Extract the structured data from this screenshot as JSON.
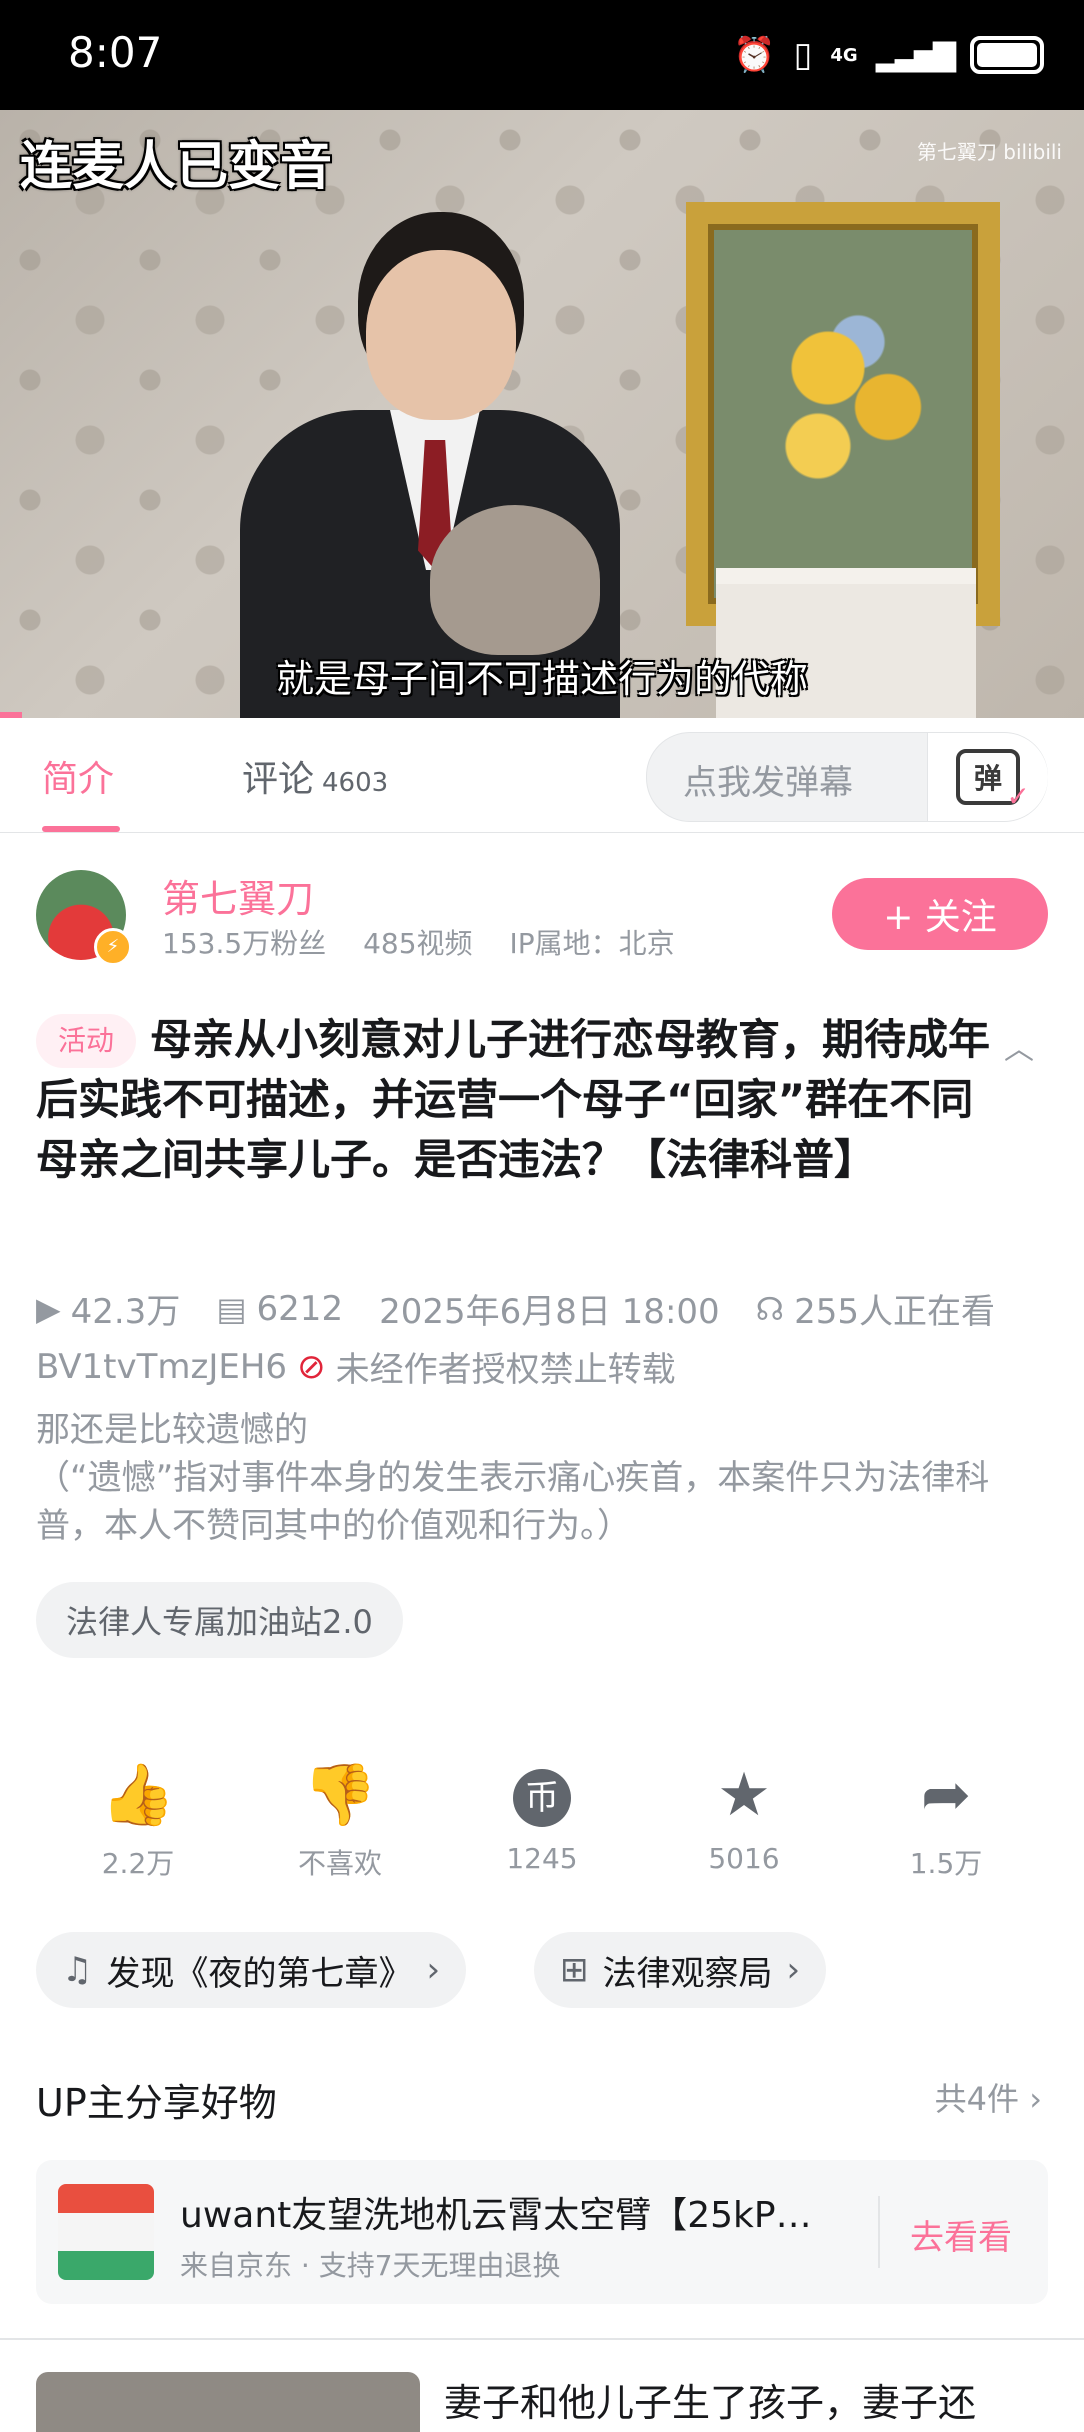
{
  "status_bar": {
    "time": "8:07",
    "network": "4G"
  },
  "video": {
    "overlay_title": "连麦人已变音",
    "watermark": "第七翼刀 bilibili",
    "subtitle": "就是母子间不可描述行为的代称",
    "progress_fraction": 0.02
  },
  "tabs": {
    "intro": "简介",
    "comments": "评论",
    "comments_count": "4603",
    "danmaku_placeholder": "点我发弹幕",
    "danmaku_icon_text": "弹"
  },
  "uploader": {
    "name": "第七翼刀",
    "fans": "153.5万粉丝",
    "videos": "485视频",
    "ip": "IP属地：北京",
    "follow_label": "+ 关注"
  },
  "video_info": {
    "tag": "活动",
    "title": "母亲从小刻意对儿子进行恋母教育，期待成年后实践不可描述，并运营一个母子“回家”群在不同母亲之间共享儿子。是否违法？【法律科普】",
    "views": "42.3万",
    "danmaku_count": "6212",
    "date": "2025年6月8日 18:00",
    "watching": "255人正在看",
    "bvid": "BV1tvTmzJEH6",
    "no_repost": "未经作者授权禁止转载",
    "desc_line1": "那还是比较遗憾的",
    "desc_line2": "（“遗憾”指对事件本身的发生表示痛心疾首，本案件只为法律科普，本人不赞同其中的价值观和行为。）",
    "chip": "法律人专属加油站2.0"
  },
  "actions": [
    {
      "label": "2.2万",
      "icon": "thumbs-up-icon"
    },
    {
      "label": "不喜欢",
      "icon": "thumbs-down-icon"
    },
    {
      "label": "1245",
      "icon": "coin-icon"
    },
    {
      "label": "5016",
      "icon": "star-icon"
    },
    {
      "label": "1.5万",
      "icon": "share-icon"
    }
  ],
  "pills": {
    "music": "发现《夜的第七章》",
    "channel": "法律观察局"
  },
  "goods": {
    "section_title": "UP主分享好物",
    "count": "共4件",
    "item_name": "uwant友望洗地机云霄太空臂【25kP…",
    "item_sub": "来自京东 · 支持7天无理由退换",
    "item_button": "去看看"
  },
  "recommend": {
    "title": "妻子和他儿子生了孩子，妻子还"
  }
}
